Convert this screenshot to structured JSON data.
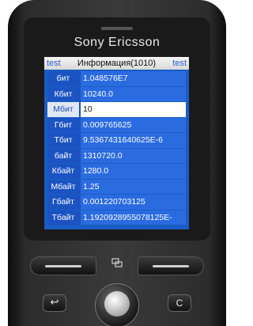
{
  "device": {
    "brand": "Sony Ericsson"
  },
  "screen": {
    "titlebar": {
      "left_softkey": "test",
      "title": "Информация(1010)",
      "right_softkey": "test"
    },
    "rows": [
      {
        "unit": "бит",
        "value": "1.048576E7"
      },
      {
        "unit": "Кбит",
        "value": "10240.0"
      },
      {
        "unit": "Мбит",
        "value": "10"
      },
      {
        "unit": "Гбит",
        "value": "0.009765625"
      },
      {
        "unit": "Тбит",
        "value": "9.5367431640625E-6"
      },
      {
        "unit": "байт",
        "value": "1310720.0"
      },
      {
        "unit": "Кбайт",
        "value": "1280.0"
      },
      {
        "unit": "Мбайт",
        "value": "1.25"
      },
      {
        "unit": "Гбайт",
        "value": "0.001220703125"
      },
      {
        "unit": "Тбайт",
        "value": "1.1920928955078125E-"
      }
    ],
    "selected_row_index": 2
  },
  "keys": {
    "menu_icon": "menu-icon",
    "back_icon": "back-arrow-icon",
    "back_glyph": "↩",
    "clear_label": "C"
  },
  "colors": {
    "screen_bg": "#1a5dc4",
    "row_value_bg": "#2a6be0",
    "selected_value_bg": "#ffffff"
  }
}
